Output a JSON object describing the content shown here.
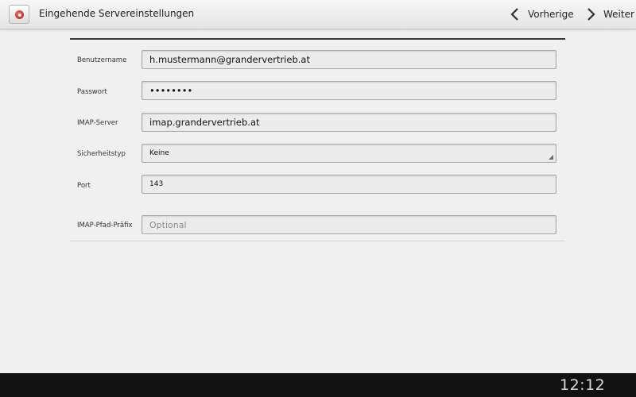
{
  "actionbar": {
    "title": "Eingehende Servereinstellungen",
    "prev_label": "Vorherige",
    "next_label": "Weiter"
  },
  "form": {
    "username_label": "Benutzername",
    "username_value": "h.mustermann@grandervertrieb.at",
    "password_label": "Passwort",
    "password_value": "••••••••",
    "server_label": "IMAP-Server",
    "server_value": "imap.grandervertrieb.at",
    "security_label": "Sicherheitstyp",
    "security_value": "Keine",
    "port_label": "Port",
    "port_value": "143",
    "prefix_label": "IMAP-Pfad-Präfix",
    "prefix_placeholder": "Optional"
  },
  "systembar": {
    "clock": "12:12"
  },
  "icons": [
    "app-icon",
    "chevron-left-icon",
    "chevron-right-icon",
    "back-icon",
    "home-icon",
    "recent-apps-icon",
    "screenshot-icon",
    "chevron-up-icon",
    "notification-icon",
    "battery-icon"
  ],
  "colors": {
    "actionbar_bg": "#ebebeb",
    "content_bg": "#f0f0f0",
    "systembar_bg": "#111111",
    "app_icon_red": "#c0261c"
  }
}
